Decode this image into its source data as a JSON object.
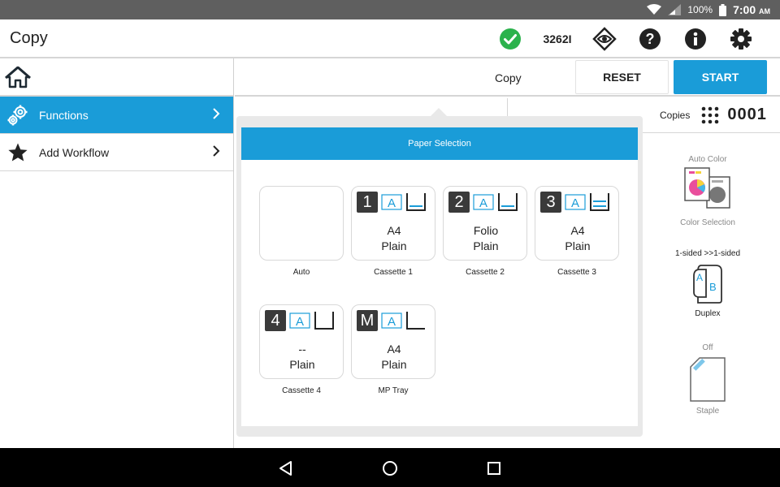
{
  "status": {
    "battery": "100%",
    "time": "7:00",
    "ampm": "AM"
  },
  "app": {
    "title": "Copy",
    "model": "3262I"
  },
  "sidebar": {
    "items": [
      {
        "label": "Functions"
      },
      {
        "label": "Add Workflow"
      }
    ]
  },
  "toolbar": {
    "mode_label": "Copy",
    "reset_label": "RESET",
    "start_label": "START"
  },
  "copies": {
    "label": "Copies",
    "value": "0001"
  },
  "side": {
    "color": {
      "caption": "Auto Color",
      "label": "Color Selection"
    },
    "duplex": {
      "caption": "1-sided >>1-sided",
      "label": "Duplex"
    },
    "staple": {
      "caption": "Off",
      "label": "Staple"
    }
  },
  "popup": {
    "title": "Paper Selection",
    "trays": [
      {
        "id": "",
        "size": "",
        "media": "",
        "caption": "Auto"
      },
      {
        "id": "1",
        "size": "A4",
        "media": "Plain",
        "caption": "Cassette 1"
      },
      {
        "id": "2",
        "size": "Folio",
        "media": "Plain",
        "caption": "Cassette 2"
      },
      {
        "id": "3",
        "size": "A4",
        "media": "Plain",
        "caption": "Cassette 3"
      },
      {
        "id": "4",
        "size": "--",
        "media": "Plain",
        "caption": "Cassette 4"
      },
      {
        "id": "M",
        "size": "A4",
        "media": "Plain",
        "caption": "MP Tray"
      }
    ]
  },
  "colors": {
    "accent": "#1a9cd8",
    "ok": "#2bb24c",
    "dark": "#3a3a3a"
  }
}
